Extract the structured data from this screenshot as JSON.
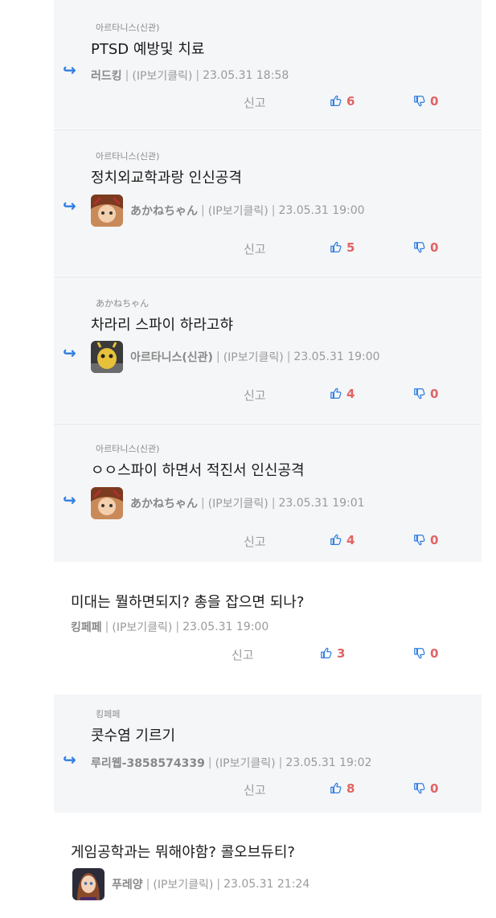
{
  "labels": {
    "report": "신고",
    "ip_label": "(IP보기클릭)"
  },
  "colors": {
    "accent_blue": "#2f7de1",
    "count_red": "#e06464",
    "reply_bg": "#f5f6f8"
  },
  "items": [
    {
      "type": "reply",
      "to": "아르타니스(신관)",
      "text": "PTSD 예방및 치료",
      "author": "러드킹",
      "time": "23.05.31 18:58",
      "likes": "6",
      "dislikes": "0"
    },
    {
      "type": "reply",
      "to": "아르타니스(신관)",
      "text": "정치외교학과랑 인신공격",
      "author": "あかねちゃん",
      "time": "23.05.31 19:00",
      "likes": "5",
      "dislikes": "0",
      "avatar": "anime-girl-avatar"
    },
    {
      "type": "reply",
      "to": "あかねちゃん",
      "text": "차라리 스파이 하라고햐",
      "author": "아르타니스(신관)",
      "time": "23.05.31 19:00",
      "likes": "4",
      "dislikes": "0",
      "avatar": "yellow-creature-avatar"
    },
    {
      "type": "reply",
      "to": "아르타니스(신관)",
      "text": "ㅇㅇ스파이 하면서 적진서 인신공격",
      "author": "あかねちゃん",
      "time": "23.05.31 19:01",
      "likes": "4",
      "dislikes": "0",
      "avatar": "anime-girl-avatar"
    },
    {
      "type": "comment",
      "text": "미대는 뭘하면되지? 총을 잡으면 되나?",
      "author": "킹페페",
      "time": "23.05.31 19:00",
      "likes": "3",
      "dislikes": "0"
    },
    {
      "type": "reply",
      "to": "킹페페",
      "text": "콧수염 기르기",
      "author": "루리웹-3858574339",
      "time": "23.05.31 19:02",
      "likes": "8",
      "dislikes": "0"
    },
    {
      "type": "comment",
      "text": "게임공학과는 뭐해야함? 콜오브듀티?",
      "author": "푸레양",
      "time": "23.05.31 21:24",
      "avatar": "brown-hair-girl-avatar"
    }
  ]
}
